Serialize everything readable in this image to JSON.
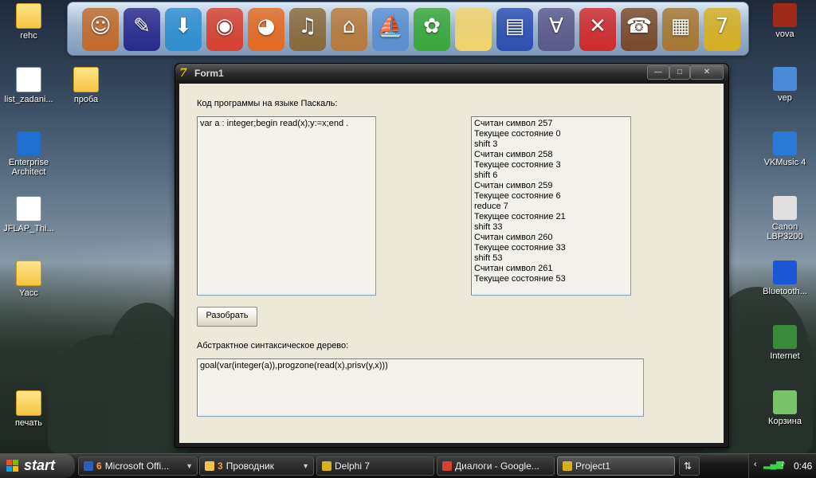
{
  "desktop": {
    "left_icons": [
      {
        "label": "rehc",
        "icon": "folder-icon"
      },
      {
        "label": "list_zadani...",
        "icon": "word-document-icon"
      },
      {
        "label": "Enterprise Architect",
        "icon": "enterprise-architect-icon"
      },
      {
        "label": "JFLAP_Thi...",
        "icon": "java-file-icon"
      },
      {
        "label": "Yacc",
        "icon": "folder-icon"
      },
      {
        "label": "печать",
        "icon": "folder-icon"
      }
    ],
    "second_column_icons": [
      {
        "label": "проба",
        "icon": "folder-icon"
      }
    ],
    "right_icons": [
      {
        "label": "vova",
        "icon": "book-icon"
      },
      {
        "label": "vep",
        "icon": "network-globe-icon"
      },
      {
        "label": "VKMusic 4",
        "icon": "vkmusic-icon"
      },
      {
        "label": "Canon LBP3200",
        "icon": "printer-icon"
      },
      {
        "label": "Bluetooth...",
        "icon": "bluetooth-icon"
      },
      {
        "label": "Internet",
        "icon": "internet-icon"
      },
      {
        "label": "Корзина",
        "icon": "recycle-bin-icon"
      }
    ]
  },
  "dock": {
    "items": [
      {
        "icon": "finder-icon",
        "color": "#c46a2a",
        "glyph": "☺"
      },
      {
        "icon": "pencil-editor-icon",
        "color": "#2a2a8c",
        "glyph": "✎"
      },
      {
        "icon": "download-arrow-icon",
        "color": "#2f8fd0",
        "glyph": "⬇"
      },
      {
        "icon": "chrome-icon",
        "color": "#d9412f",
        "glyph": "◉"
      },
      {
        "icon": "firefox-icon",
        "color": "#e66a1f",
        "glyph": "◕"
      },
      {
        "icon": "gramophone-icon",
        "color": "#8a6a3a",
        "glyph": "♫"
      },
      {
        "icon": "house-icon",
        "color": "#b87a3a",
        "glyph": "⌂"
      },
      {
        "icon": "paper-boat-icon",
        "color": "#5b8fd1",
        "glyph": "⛵"
      },
      {
        "icon": "icq-flower-icon",
        "color": "#3aa83a",
        "glyph": "✿"
      },
      {
        "icon": "folder-icon",
        "color": "#f3d46a",
        "glyph": ""
      },
      {
        "icon": "floppy-document-icon",
        "color": "#2d4fb0",
        "glyph": "▤"
      },
      {
        "icon": "formula-icon",
        "color": "#5a5a8a",
        "glyph": "∀"
      },
      {
        "icon": "xo-game-icon",
        "color": "#d02a2a",
        "glyph": "✕"
      },
      {
        "icon": "phone-icon",
        "color": "#7a4a2a",
        "glyph": "☎"
      },
      {
        "icon": "dosbox-icon",
        "color": "#a87830",
        "glyph": "▦"
      },
      {
        "icon": "delphi-7-icon",
        "color": "#d8b020",
        "glyph": "7"
      }
    ]
  },
  "window": {
    "title": "Form1",
    "title_icon": "7",
    "buttons": {
      "minimize": "—",
      "maximize": "□",
      "close": "✕"
    },
    "source_label": "Код программы на языке Паскаль:",
    "source_code": "var a : integer;begin read(x);y:=x;end .",
    "log_lines": [
      "Считан символ 257",
      "Текущее состояние 0",
      "shift 3",
      "Считан символ 258",
      "Текущее состояние 3",
      "shift 6",
      "Считан символ 259",
      "Текущее состояние 6",
      "reduce 7",
      "Текущее состояние 21",
      "shift 33",
      "Считан символ 260",
      "Текущее состояние 33",
      "shift 53",
      "Считан символ 261",
      "Текущее состояние 53"
    ],
    "parse_button": "Разобрать",
    "tree_label": "Абстрактное синтаксическое дерево:",
    "tree_output": "goal(var(integer(a)),progzone(read(x),prisv(y,x)))"
  },
  "taskbar": {
    "start_label": "start",
    "tasks": [
      {
        "count": "6",
        "label": "Microsoft Offi...",
        "icon": "word-icon",
        "color": "#2b5fb8",
        "grouped": true,
        "active": false
      },
      {
        "count": "3",
        "label": "Проводник",
        "icon": "folder-icon",
        "color": "#f3c24a",
        "grouped": true,
        "active": false
      },
      {
        "count": "",
        "label": "Delphi 7",
        "icon": "delphi-icon",
        "color": "#d8b020",
        "grouped": false,
        "active": false
      },
      {
        "count": "",
        "label": "Диалоги - Google...",
        "icon": "chrome-icon",
        "color": "#d9412f",
        "grouped": false,
        "active": false
      },
      {
        "count": "",
        "label": "Project1",
        "icon": "delphi-icon",
        "color": "#d8b020",
        "grouped": false,
        "active": true
      }
    ],
    "clock": "0:46"
  }
}
